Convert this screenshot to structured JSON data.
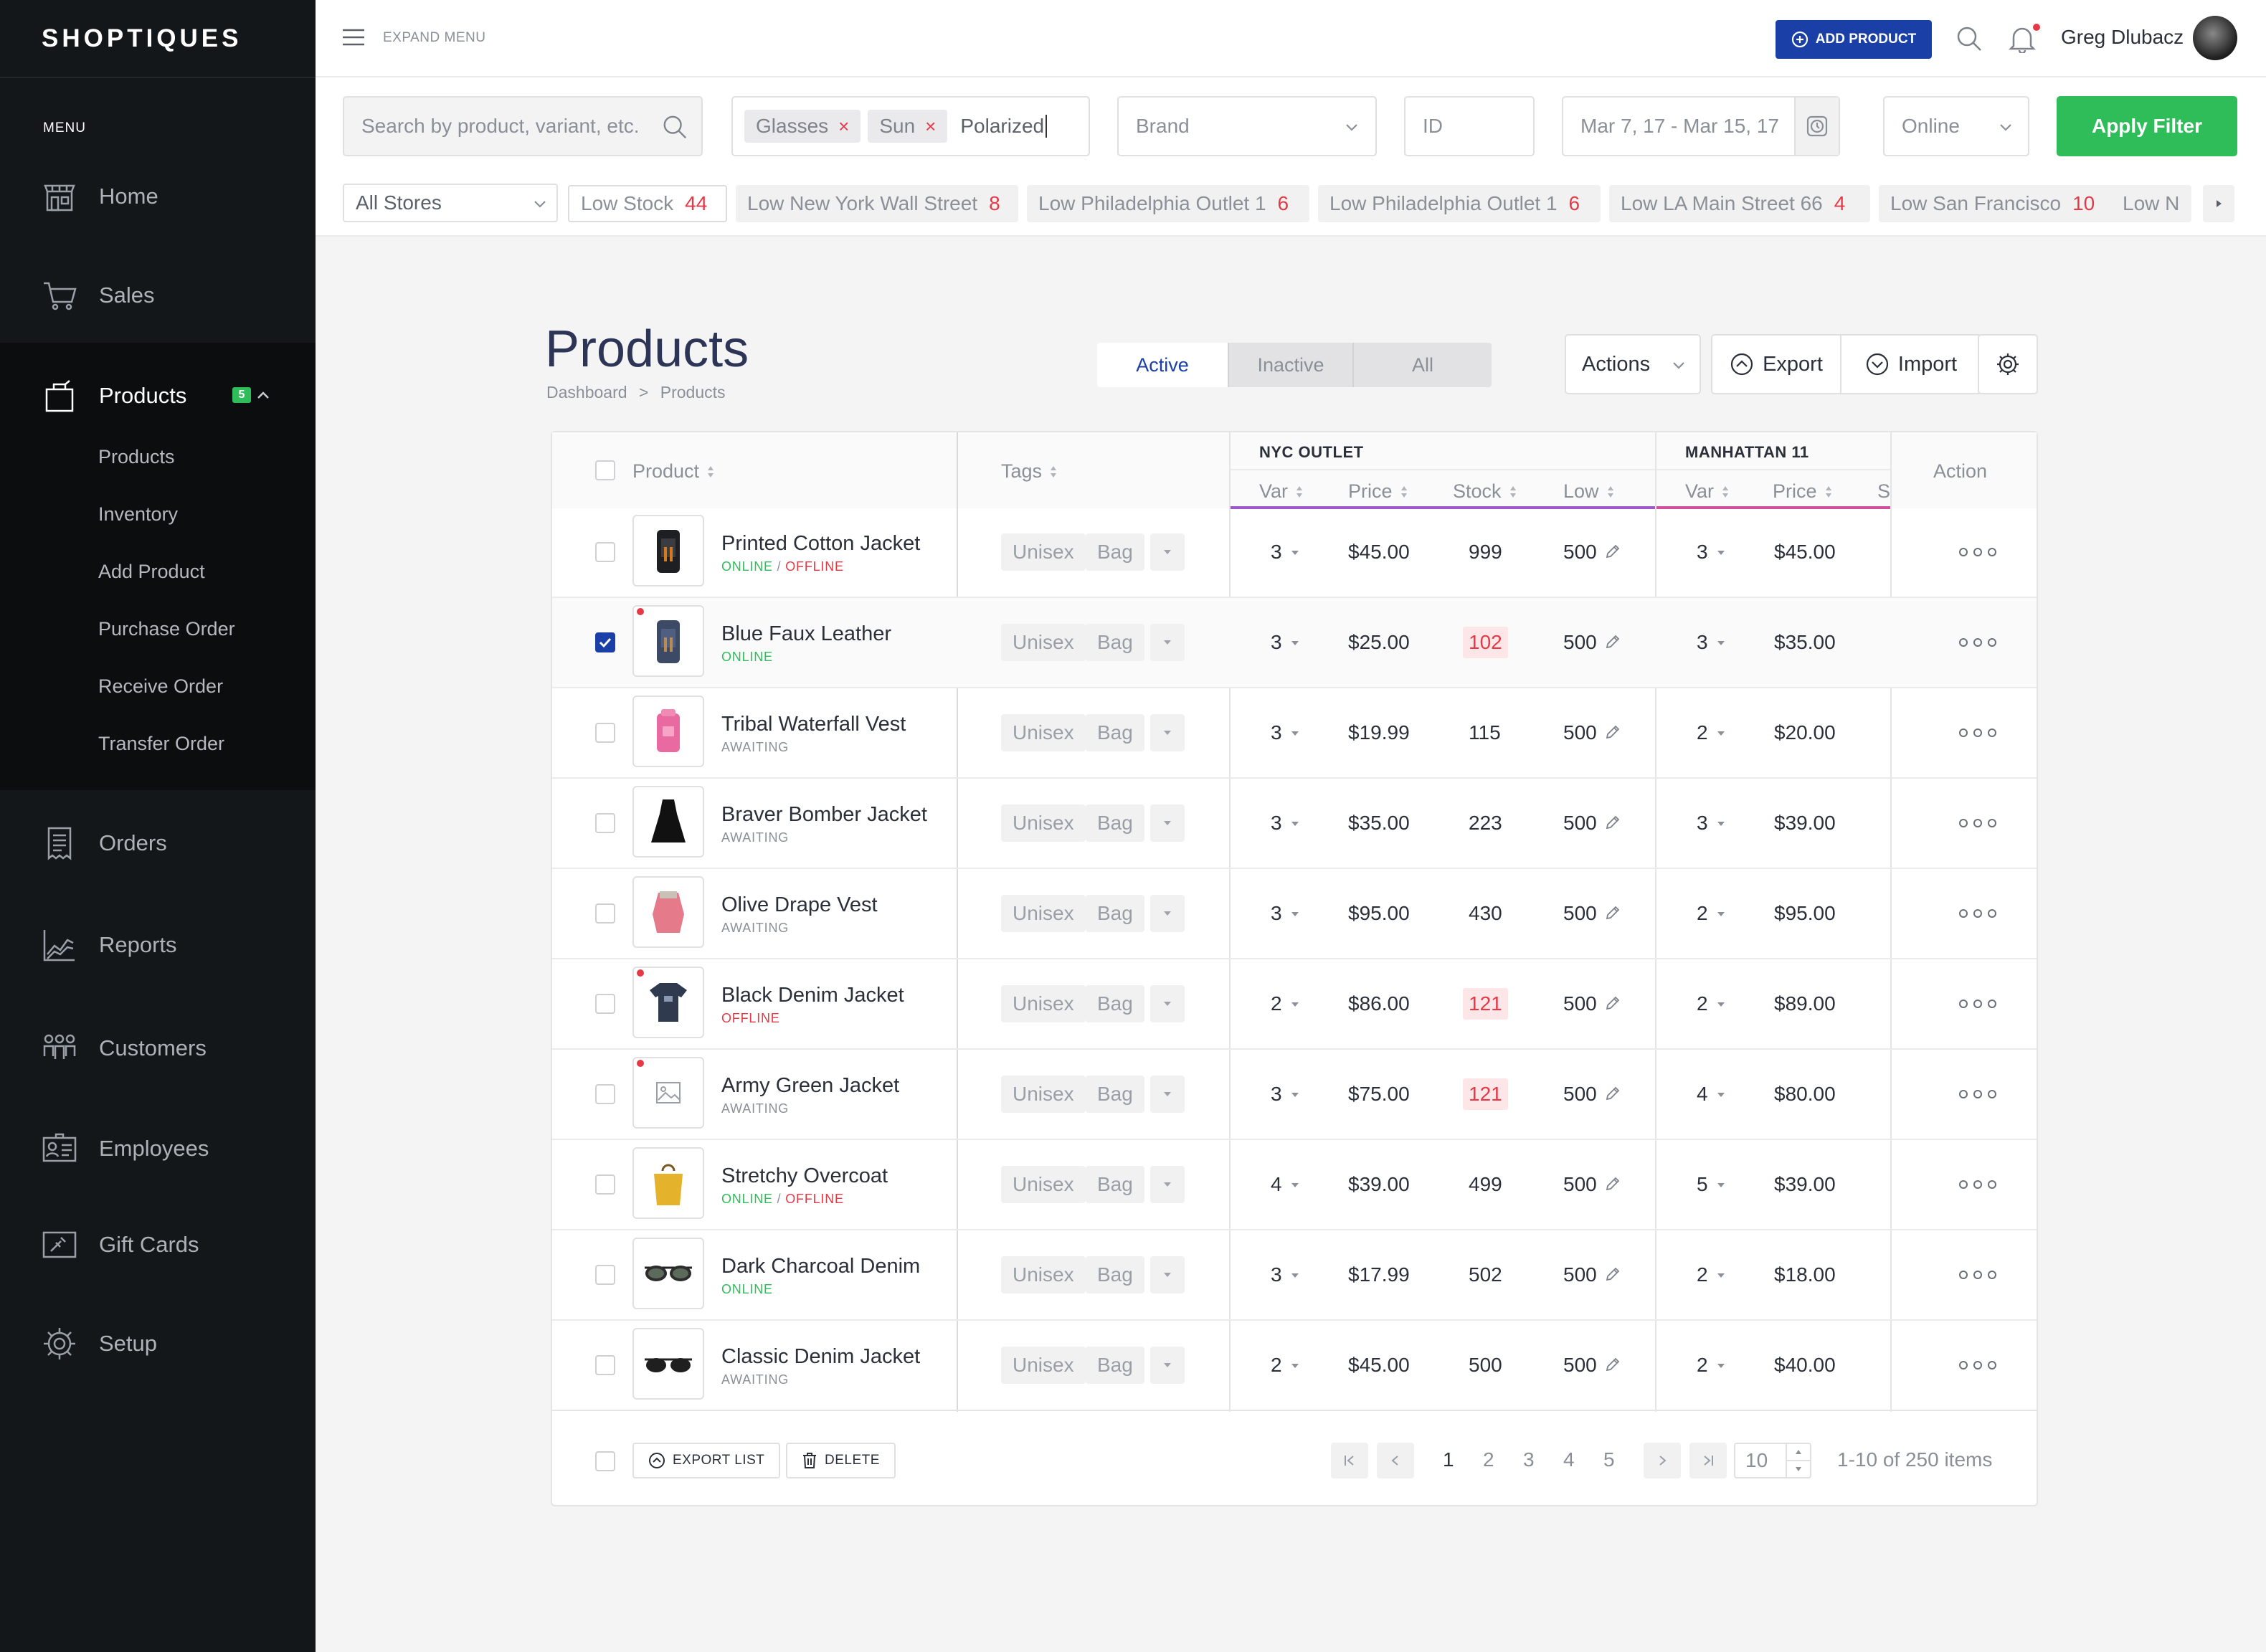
{
  "brand": "SHOPTIQUES",
  "sidebar": {
    "menu_label": "MENU",
    "items": [
      {
        "label": "Home",
        "icon": "store-icon"
      },
      {
        "label": "Sales",
        "icon": "cart-icon"
      },
      {
        "label": "Products",
        "icon": "bag-icon",
        "badge": "5"
      },
      {
        "label": "Orders",
        "icon": "receipt-icon"
      },
      {
        "label": "Reports",
        "icon": "chart-icon"
      },
      {
        "label": "Customers",
        "icon": "users-icon"
      },
      {
        "label": "Employees",
        "icon": "id-card-icon"
      },
      {
        "label": "Gift Cards",
        "icon": "gift-card-icon"
      },
      {
        "label": "Setup",
        "icon": "gear-icon"
      }
    ],
    "sub_items": [
      "Products",
      "Inventory",
      "Add Product",
      "Purchase Order",
      "Receive Order",
      "Transfer Order"
    ]
  },
  "topbar": {
    "expand_menu": "EXPAND MENU",
    "add_product": "ADD PRODUCT",
    "user_name": "Greg Dlubacz"
  },
  "filters": {
    "search_placeholder": "Search by product, variant, etc.",
    "chips": [
      "Glasses",
      "Sun"
    ],
    "typed": "Polarized",
    "brand": "Brand",
    "id": "ID",
    "date_range": "Mar 7, 17 - Mar 15, 17",
    "channel": "Online",
    "apply": "Apply Filter",
    "store": "All Stores",
    "low_chips": [
      {
        "label": "Low Stock",
        "count": "44"
      },
      {
        "label": "Low New York Wall Street",
        "count": "8"
      },
      {
        "label": "Low Philadelphia Outlet 1",
        "count": "6"
      },
      {
        "label": "Low Philadelphia Outlet 1",
        "count": "6"
      },
      {
        "label": "Low LA Main Street 66",
        "count": "4"
      },
      {
        "label": "Low San Francisco",
        "count": "10"
      },
      {
        "label": "Low N",
        "count": ""
      }
    ]
  },
  "page": {
    "title": "Products",
    "breadcrumb": [
      "Dashboard",
      "Products"
    ],
    "tabs": [
      "Active",
      "Inactive",
      "All"
    ],
    "actions": "Actions",
    "export": "Export",
    "import": "Import"
  },
  "table": {
    "headers": {
      "product": "Product",
      "tags": "Tags",
      "action": "Action"
    },
    "groups": [
      "NYC OUTLET",
      "MANHATTAN 11"
    ],
    "sub_headers": [
      "Var",
      "Price",
      "Stock",
      "Low",
      "Var",
      "Price",
      "S"
    ],
    "rows": [
      {
        "name": "Printed Cotton Jacket",
        "status": [
          "ONLINE",
          "OFFLINE"
        ],
        "tags": [
          "Unisex",
          "Bag"
        ],
        "var1": "3",
        "price1": "$45.00",
        "stock": "999",
        "low": "500",
        "var2": "3",
        "price2": "$45.00",
        "stock_hi": false,
        "dot": false,
        "checked": false
      },
      {
        "name": "Blue Faux Leather",
        "status": [
          "ONLINE"
        ],
        "tags": [
          "Unisex",
          "Bag"
        ],
        "var1": "3",
        "price1": "$25.00",
        "stock": "102",
        "low": "500",
        "var2": "3",
        "price2": "$35.00",
        "stock_hi": true,
        "dot": true,
        "checked": true
      },
      {
        "name": "Tribal Waterfall Vest",
        "status": [
          "AWAITING"
        ],
        "tags": [
          "Unisex",
          "Bag"
        ],
        "var1": "3",
        "price1": "$19.99",
        "stock": "115",
        "low": "500",
        "var2": "2",
        "price2": "$20.00",
        "stock_hi": false,
        "dot": false,
        "checked": false
      },
      {
        "name": "Braver Bomber Jacket",
        "status": [
          "AWAITING"
        ],
        "tags": [
          "Unisex",
          "Bag"
        ],
        "var1": "3",
        "price1": "$35.00",
        "stock": "223",
        "low": "500",
        "var2": "3",
        "price2": "$39.00",
        "stock_hi": false,
        "dot": false,
        "checked": false
      },
      {
        "name": "Olive Drape Vest",
        "status": [
          "AWAITING"
        ],
        "tags": [
          "Unisex",
          "Bag"
        ],
        "var1": "3",
        "price1": "$95.00",
        "stock": "430",
        "low": "500",
        "var2": "2",
        "price2": "$95.00",
        "stock_hi": false,
        "dot": false,
        "checked": false
      },
      {
        "name": "Black Denim Jacket",
        "status": [
          "OFFLINE"
        ],
        "tags": [
          "Unisex",
          "Bag"
        ],
        "var1": "2",
        "price1": "$86.00",
        "stock": "121",
        "low": "500",
        "var2": "2",
        "price2": "$89.00",
        "stock_hi": true,
        "dot": true,
        "checked": false
      },
      {
        "name": "Army Green Jacket",
        "status": [
          "AWAITING"
        ],
        "tags": [
          "Unisex",
          "Bag"
        ],
        "var1": "3",
        "price1": "$75.00",
        "stock": "121",
        "low": "500",
        "var2": "4",
        "price2": "$80.00",
        "stock_hi": true,
        "dot": true,
        "checked": false
      },
      {
        "name": "Stretchy Overcoat",
        "status": [
          "ONLINE",
          "OFFLINE"
        ],
        "tags": [
          "Unisex",
          "Bag"
        ],
        "var1": "4",
        "price1": "$39.00",
        "stock": "499",
        "low": "500",
        "var2": "5",
        "price2": "$39.00",
        "stock_hi": false,
        "dot": false,
        "checked": false
      },
      {
        "name": "Dark Charcoal Denim",
        "status": [
          "ONLINE"
        ],
        "tags": [
          "Unisex",
          "Bag"
        ],
        "var1": "3",
        "price1": "$17.99",
        "stock": "502",
        "low": "500",
        "var2": "2",
        "price2": "$18.00",
        "stock_hi": false,
        "dot": false,
        "checked": false
      },
      {
        "name": "Classic Denim Jacket",
        "status": [
          "AWAITING"
        ],
        "tags": [
          "Unisex",
          "Bag"
        ],
        "var1": "2",
        "price1": "$45.00",
        "stock": "500",
        "low": "500",
        "var2": "2",
        "price2": "$40.00",
        "stock_hi": false,
        "dot": false,
        "checked": false
      }
    ]
  },
  "footer": {
    "export_list": "EXPORT LIST",
    "delete": "DELETE",
    "pages": [
      "1",
      "2",
      "3",
      "4",
      "5"
    ],
    "current_page": "1",
    "per_page": "10",
    "info": "1-10 of 250 items"
  },
  "colors": {
    "sidebar": "#14171a",
    "accent": "#1a3fa6",
    "green": "#2ebd59",
    "red": "#e53946",
    "nyc_underline": "#9b59c9",
    "manhattan_underline": "#d0509b"
  }
}
